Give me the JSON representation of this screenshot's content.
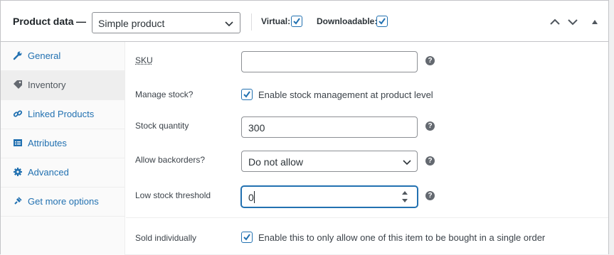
{
  "header": {
    "title": "Product data",
    "dash": "—",
    "product_type": "Simple product",
    "virtual_label": "Virtual:",
    "virtual_checked": true,
    "downloadable_label": "Downloadable:",
    "downloadable_checked": true
  },
  "sidebar": {
    "items": [
      {
        "label": "General",
        "icon": "wrench-icon",
        "active": false
      },
      {
        "label": "Inventory",
        "icon": "tag-icon",
        "active": true
      },
      {
        "label": "Linked Products",
        "icon": "link-icon",
        "active": false
      },
      {
        "label": "Attributes",
        "icon": "list-icon",
        "active": false
      },
      {
        "label": "Advanced",
        "icon": "gear-icon",
        "active": false
      },
      {
        "label": "Get more options",
        "icon": "plugin-icon",
        "active": false
      }
    ]
  },
  "inventory": {
    "sku_label": "SKU",
    "sku_value": "",
    "manage_stock_label": "Manage stock?",
    "manage_stock_checked": true,
    "manage_stock_text": "Enable stock management at product level",
    "stock_qty_label": "Stock quantity",
    "stock_qty_value": "300",
    "backorders_label": "Allow backorders?",
    "backorders_value": "Do not allow",
    "low_stock_label": "Low stock threshold",
    "low_stock_value": "0",
    "sold_individually_label": "Sold individually",
    "sold_individually_checked": true,
    "sold_individually_text": "Enable this to only allow one of this item to be bought in a single order",
    "help_glyph": "?"
  },
  "colors": {
    "link": "#2271b1",
    "accent": "#2271b1",
    "text": "#3c434a"
  }
}
